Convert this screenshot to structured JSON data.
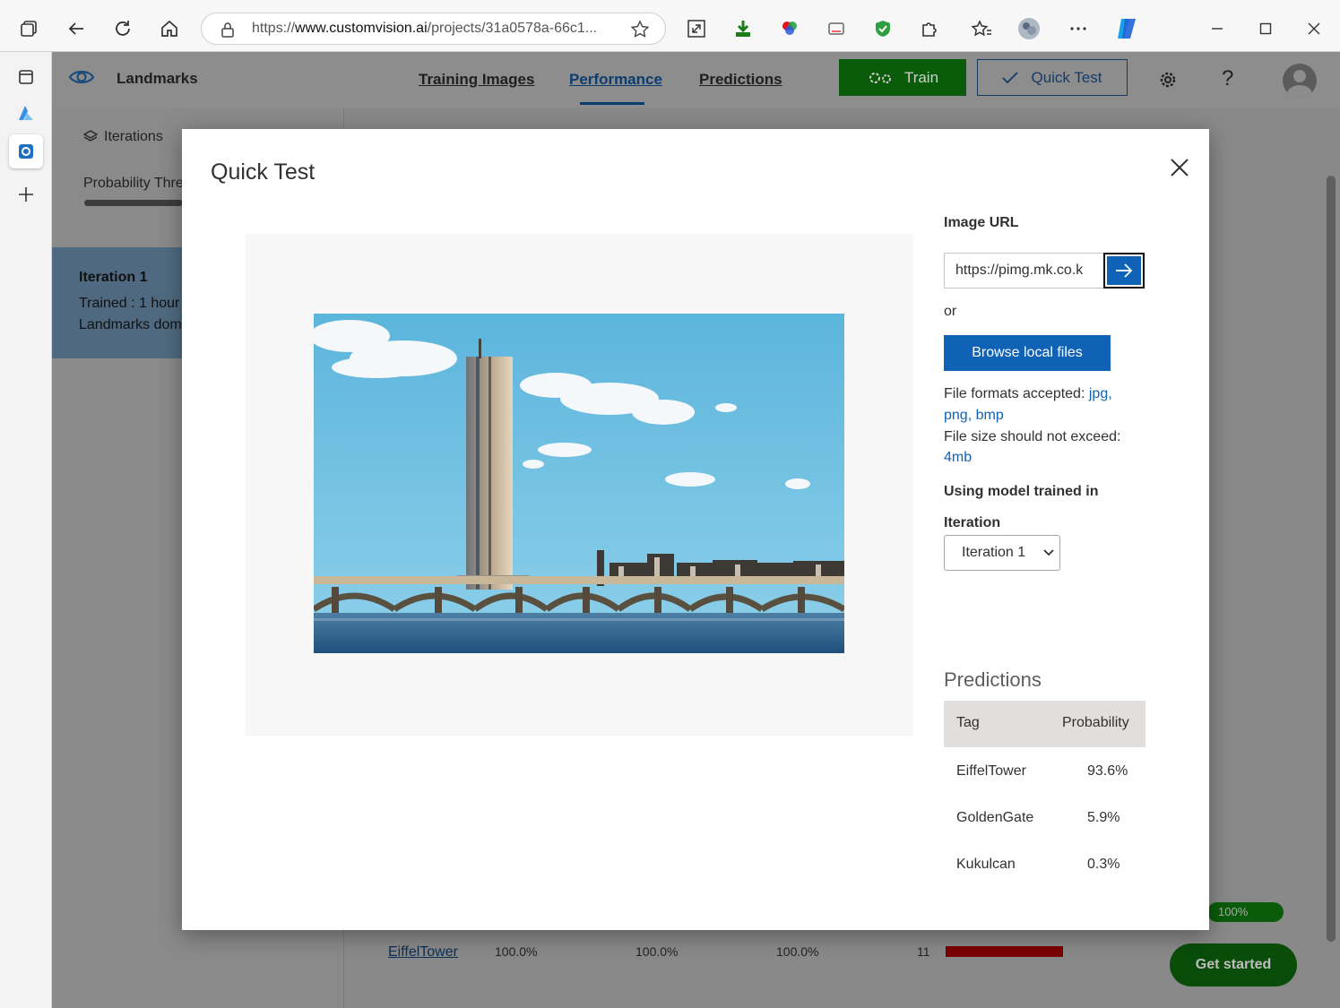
{
  "browser": {
    "url_prefix": "https://",
    "url_host": "www.customvision.ai",
    "url_path": "/projects/31a0578a-66c1..."
  },
  "app": {
    "project_name": "Landmarks",
    "nav": [
      "Training Images",
      "Performance",
      "Predictions"
    ],
    "train_label": "Train",
    "quick_test_label": "Quick Test"
  },
  "left_pane": {
    "iterations_label": "Iterations",
    "probability_label": "Probability Thre",
    "iteration_title": "Iteration 1",
    "iteration_trained": "Trained : 1 hour",
    "iteration_domain": "Landmarks dom"
  },
  "background_table": {
    "tag": "EiffelTower",
    "precision": "100.0%",
    "recall": "100.0%",
    "ap": "100.0%",
    "count": "11",
    "progress_label": "100%",
    "get_started": "Get started"
  },
  "modal": {
    "title": "Quick Test",
    "image_url_label": "Image URL",
    "image_url_value": "https://pimg.mk.co.k",
    "or_label": "or",
    "browse_label": "Browse local files",
    "formats_prefix": "File formats accepted:",
    "format_jpg": "jpg,",
    "format_png": "png,",
    "format_bmp": "bmp",
    "size_text": "File size should not exceed:",
    "size_value": "4mb",
    "model_label": "Using model trained in",
    "iteration_label": "Iteration",
    "iteration_selected": "Iteration 1",
    "predictions_title": "Predictions",
    "col_tag": "Tag",
    "col_probability": "Probability",
    "predictions": [
      {
        "tag": "EiffelTower",
        "probability": "93.6%"
      },
      {
        "tag": "GoldenGate",
        "probability": "5.9%"
      },
      {
        "tag": "Kukulcan",
        "probability": "0.3%"
      }
    ]
  },
  "colors": {
    "accent": "#0f62b6",
    "train_green": "#107c10",
    "overlay": "#898989"
  }
}
